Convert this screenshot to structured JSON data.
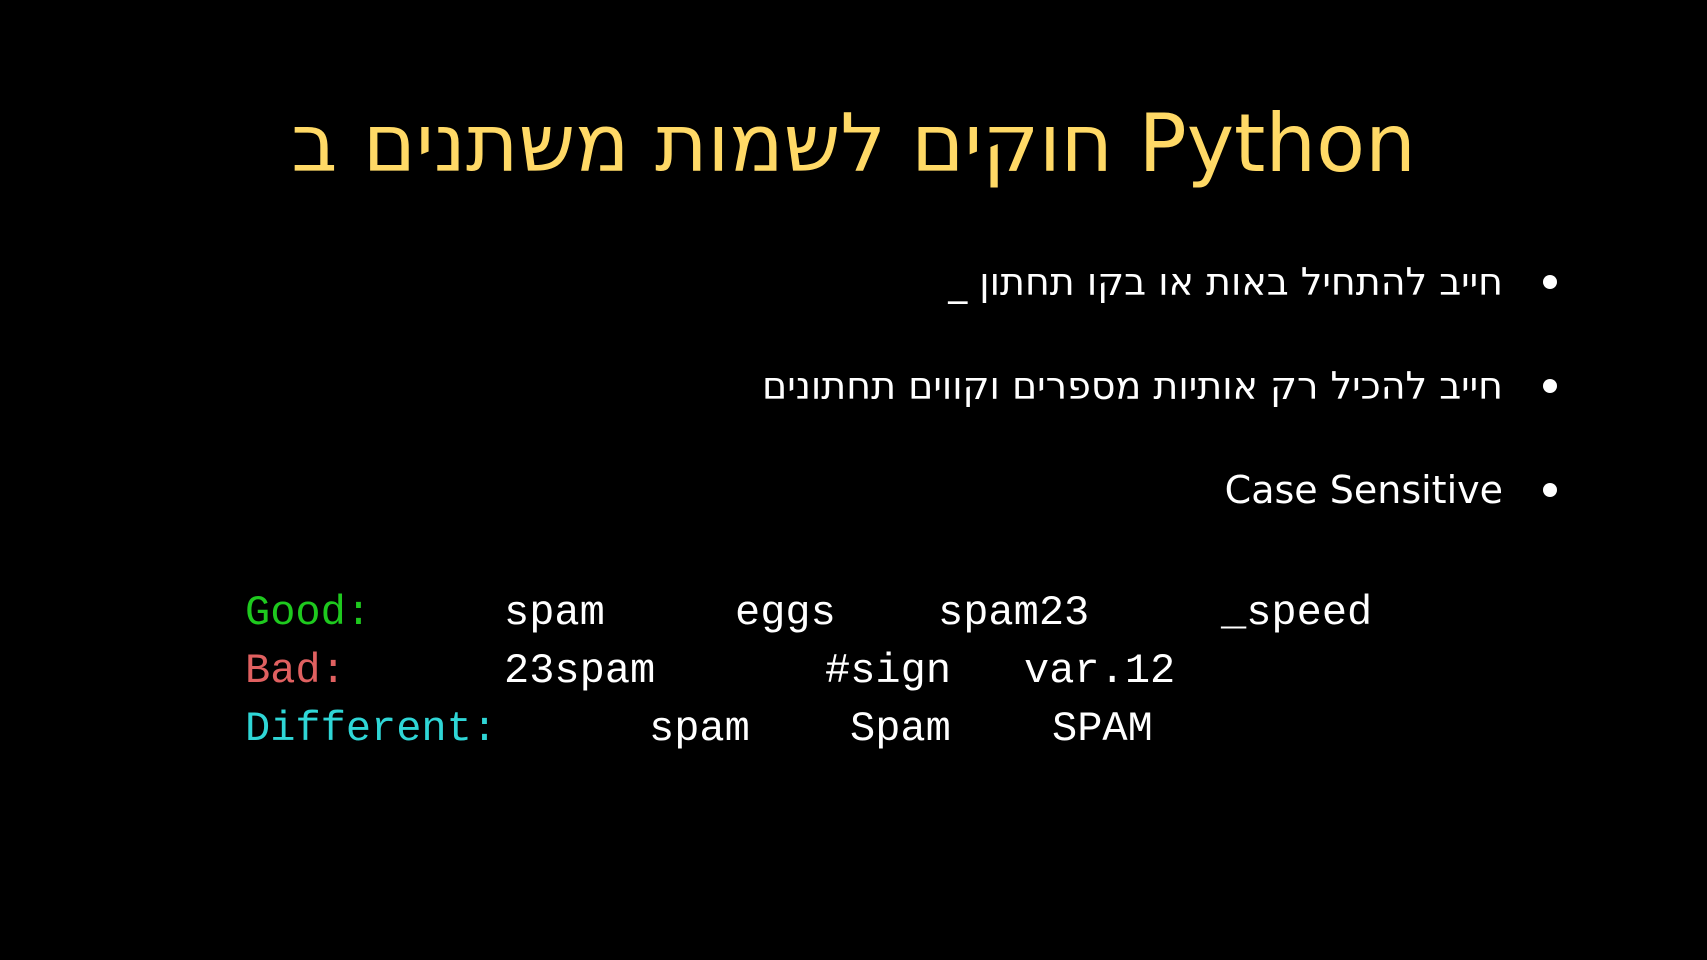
{
  "slide": {
    "title": "חוקים לשמות משתנים ב Python",
    "bullets": [
      "חייב להתחיל באות או בקו תחתון _",
      "חייב להכיל רק אותיות מספרים וקווים תחתונים",
      "Case Sensitive"
    ],
    "examples": {
      "good": {
        "label": "Good:",
        "items": [
          "spam",
          "eggs",
          "spam23",
          "_speed"
        ]
      },
      "bad": {
        "label": "Bad:",
        "items": [
          "23spam",
          "#sign",
          "var.12"
        ]
      },
      "different": {
        "label": "Different:",
        "items": [
          "spam",
          "Spam",
          "SPAM"
        ]
      }
    },
    "colors": {
      "background": "#000000",
      "title": "#FFD966",
      "text": "#FFFFFF",
      "good_label": "#1EC91E",
      "bad_label": "#E06060",
      "different_label": "#2FD6D6"
    }
  }
}
